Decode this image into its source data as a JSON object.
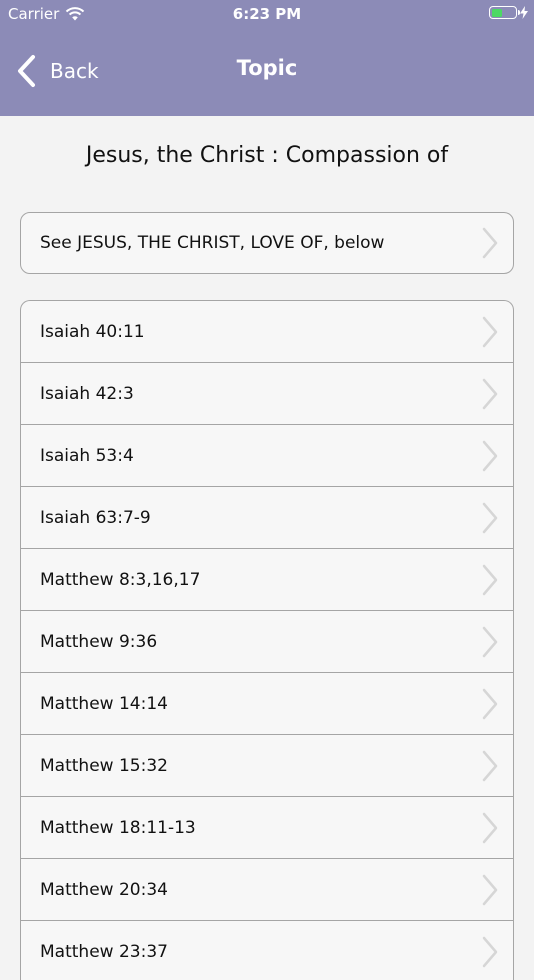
{
  "status_bar": {
    "carrier": "Carrier",
    "time": "6:23 PM",
    "battery_level": 0.45
  },
  "nav": {
    "back_label": "Back",
    "title": "Topic"
  },
  "page": {
    "title": "Jesus, the Christ : Compassion of"
  },
  "see_also": {
    "label": "See JESUS, THE CHRIST, LOVE OF, below"
  },
  "references": [
    "Isaiah 40:11",
    "Isaiah 42:3",
    "Isaiah 53:4",
    "Isaiah 63:7-9",
    "Matthew 8:3,16,17",
    "Matthew 9:36",
    "Matthew 14:14",
    "Matthew 15:32",
    "Matthew 18:11-13",
    "Matthew 20:34",
    "Matthew 23:37"
  ],
  "colors": {
    "nav_background": "#8c8bb7",
    "page_background": "#f3f3f3",
    "cell_background": "#f7f7f7",
    "cell_border": "#a5a5a5",
    "battery_fill": "#4cd964"
  },
  "icons": {
    "wifi": "wifi-icon",
    "battery": "battery-icon",
    "charging": "charging-bolt-icon",
    "back": "chevron-left-icon",
    "disclosure": "chevron-right-icon"
  }
}
